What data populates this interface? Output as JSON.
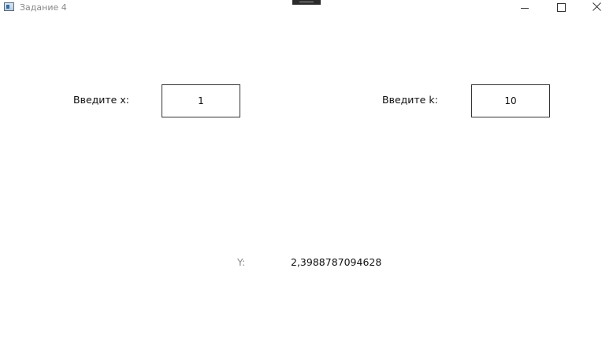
{
  "window": {
    "title": "Задание 4"
  },
  "form": {
    "x_label": "Введите x:",
    "x_value": "1",
    "k_label": "Введите k:",
    "k_value": "10",
    "y_label": "Y:",
    "y_value": "2,3988787094628"
  },
  "icons": {
    "app": "app-window-icon",
    "minimize": "minimize-icon",
    "maximize": "maximize-icon",
    "close": "close-icon"
  },
  "colors": {
    "background": "#ffffff",
    "text": "#111111",
    "muted_label": "#8a8a8a",
    "border": "#333333"
  }
}
